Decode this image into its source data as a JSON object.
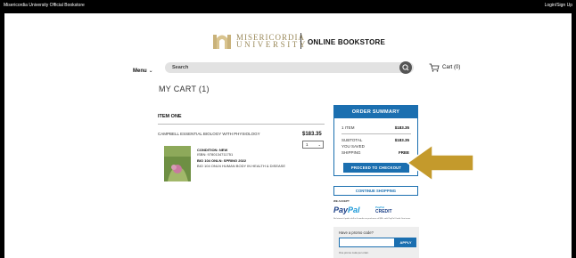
{
  "topbar": {
    "left_text": "Misericordia University Official Bookstore",
    "right_text": "Login/Sign Up"
  },
  "header": {
    "logo_line1": "MISERICORDIA",
    "logo_line2": "UNIVERSITY",
    "store_title": "ONLINE BOOKSTORE"
  },
  "nav": {
    "menu_label": "Menu",
    "search_placeholder": "Search",
    "cart_label": "Cart (0)"
  },
  "cart": {
    "title": "MY CART (1)",
    "item_heading": "ITEM ONE",
    "item": {
      "title": "CAMPBELL ESSENTIAL BIOLOGY WITH PHYSIOLOGY",
      "price": "$183.35",
      "qty": "1",
      "condition": "CONDITION: NEW",
      "isbn": "ISBN: 9780134711751",
      "course_line1": "BIO 104 ONLN: SPRING 2022",
      "course_line2": "BIO 104 ONLN HUMAN BODY IN HEALTH & DISEASE",
      "cover_text": "Essential Biology"
    }
  },
  "summary": {
    "heading": "ORDER SUMMARY",
    "rows": [
      {
        "label": "1 ITEM",
        "value": "$183.35"
      },
      {
        "label": "SUBTOTAL",
        "value": "$183.35"
      },
      {
        "label": "YOU SAVED",
        "value": ""
      },
      {
        "label": "SHIPPING",
        "value": "FREE"
      }
    ],
    "checkout_label": "PROCEED TO CHECKOUT",
    "continue_label": "CONTINUE SHOPPING"
  },
  "payments": {
    "accept_label": "WE ACCEPT",
    "paypal_a": "Pay",
    "paypal_b": "Pal",
    "credit_small": "PayPal",
    "credit_big": "CREDIT",
    "fine_print": "No Interest if paid in full in 6 months on purchases of $99+ with PayPal Credit. See terms."
  },
  "promo": {
    "question": "Have a promo code?",
    "input_value": "",
    "apply_label": "APPLY",
    "note": "One promo code per order."
  },
  "colors": {
    "accent": "#1b6fb0",
    "arrow": "#c49a2c",
    "logo_gold": "#9b8a5b"
  }
}
